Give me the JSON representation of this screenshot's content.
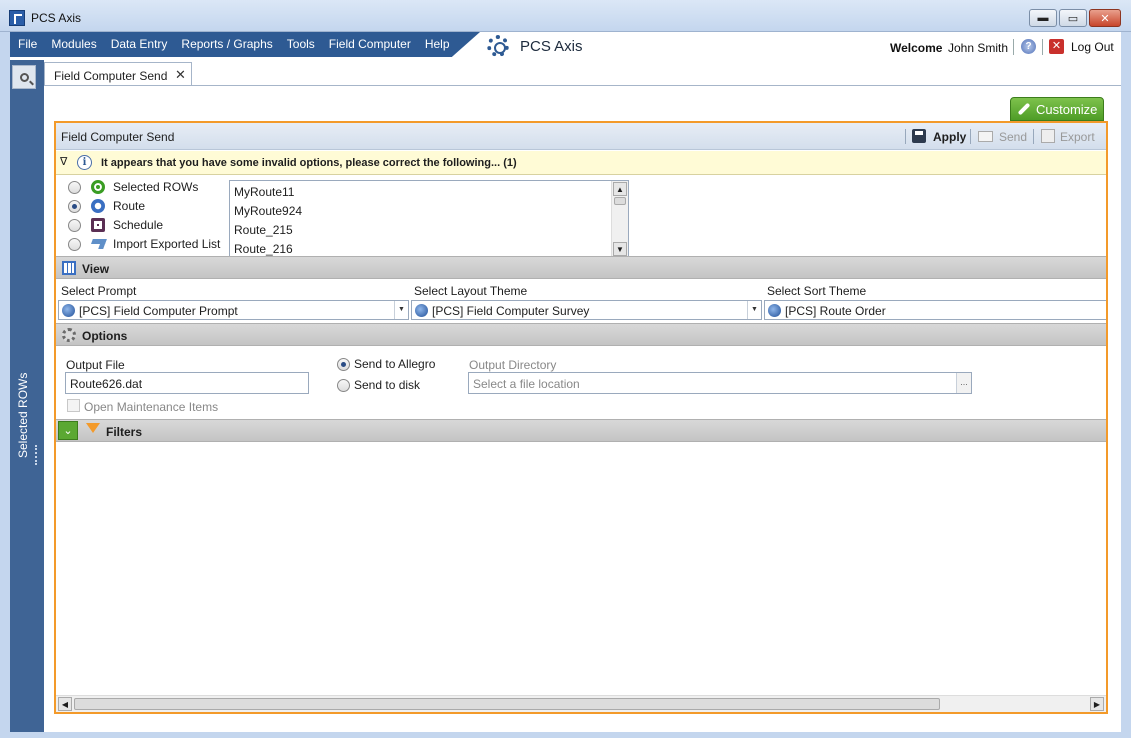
{
  "window": {
    "title": "PCS Axis",
    "minimize": "▬",
    "maximize": "▭",
    "close": "✕"
  },
  "menu": {
    "items": [
      "File",
      "Modules",
      "Data Entry",
      "Reports / Graphs",
      "Tools",
      "Field Computer",
      "Help"
    ],
    "logo_text": "PCS Axis",
    "welcome": "Welcome",
    "user": "John Smith",
    "help_glyph": "?",
    "logout_glyph": "✕",
    "logout": "Log Out"
  },
  "sidebar": {
    "vertical_label": "Selected ROWs"
  },
  "tab": {
    "label": "Field Computer Send",
    "close": "✕"
  },
  "customize_label": "Customize",
  "panel": {
    "title": "Field Computer Send",
    "toolbar": {
      "apply": "Apply",
      "send": "Send",
      "export": "Export"
    },
    "warning": {
      "toggle": "∇",
      "icon": "i",
      "text": "It appears that you have some invalid options, please correct the following...  (1)"
    },
    "sources": [
      {
        "label": "Selected ROWs",
        "selected": false,
        "icon": "selected-rows-icon",
        "color": "#3a9d23"
      },
      {
        "label": "Route",
        "selected": true,
        "icon": "route-compass-icon",
        "color": "#3a6fc2"
      },
      {
        "label": "Schedule",
        "selected": false,
        "icon": "schedule-clock-icon",
        "color": "#5b2f54"
      },
      {
        "label": "Import Exported List",
        "selected": false,
        "icon": "import-arrow-icon",
        "color": "#5f8fc8"
      }
    ],
    "routes": [
      "MyRoute11",
      "MyRoute924",
      "Route_215",
      "Route_216"
    ],
    "view": {
      "title": "View",
      "prompt_label": "Select Prompt",
      "prompt_value": "[PCS] Field Computer Prompt",
      "layout_label": "Select Layout Theme",
      "layout_value": "[PCS] Field Computer Survey",
      "sort_label": "Select Sort Theme",
      "sort_value": "[PCS] Route Order"
    },
    "options": {
      "title": "Options",
      "output_file_label": "Output File",
      "output_file_value": "Route626.dat",
      "send_allegro": "Send to Allegro",
      "send_disk": "Send to disk",
      "send_target": "allegro",
      "output_dir_label": "Output Directory",
      "output_dir_placeholder": "Select a file location",
      "browse": "...",
      "maintenance_label": "Open Maintenance Items"
    },
    "filters": {
      "title": "Filters"
    }
  },
  "colors": {
    "accent_orange": "#f39a2a",
    "menu_blue": "#2e5a93",
    "customize_green": "#5ba832"
  }
}
